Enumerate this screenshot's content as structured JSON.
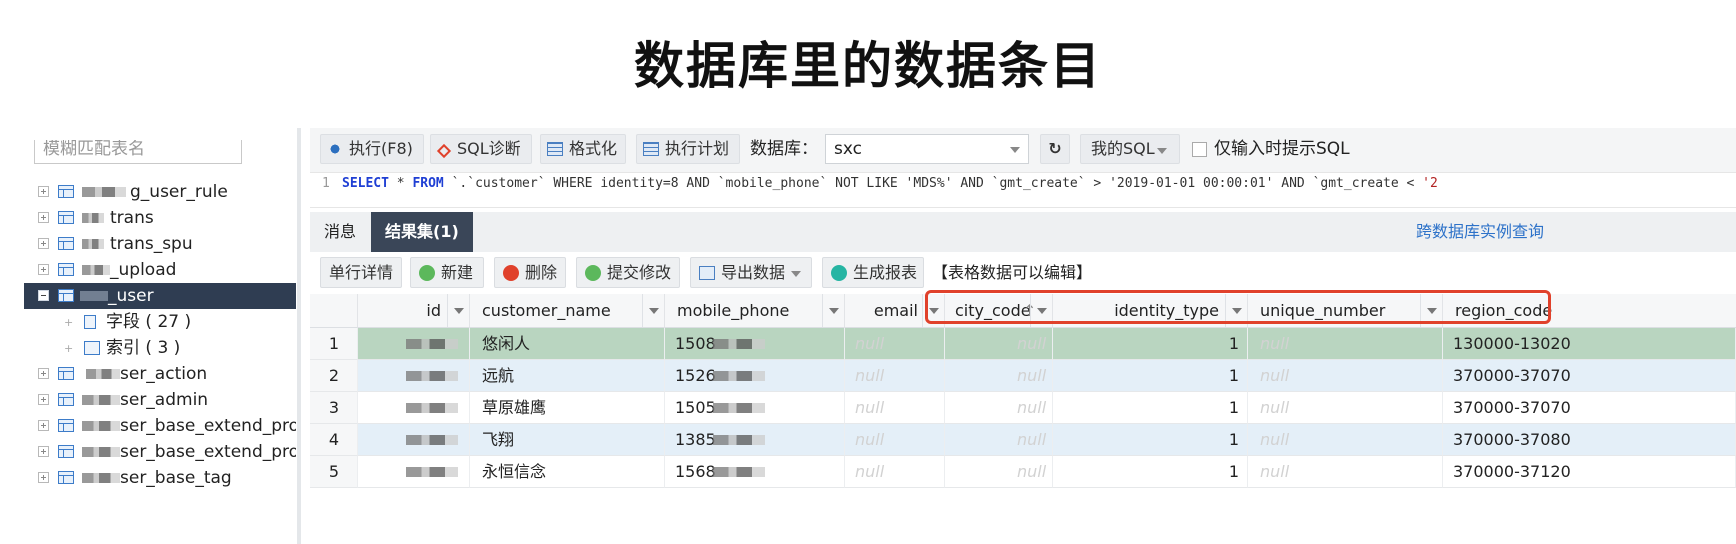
{
  "page_title": "数据库里的数据条目",
  "sidebar": {
    "search_placeholder": "模糊匹配表名",
    "items": [
      {
        "label": "g_user_rule"
      },
      {
        "label": "trans"
      },
      {
        "label": "trans_spu"
      },
      {
        "label": "_upload"
      },
      {
        "label": "_user"
      },
      {
        "label": "字段 ( 27 )"
      },
      {
        "label": "索引 ( 3 )"
      },
      {
        "label": "ser_action"
      },
      {
        "label": "ser_admin"
      },
      {
        "label": "ser_base_extend_propert"
      },
      {
        "label": "ser_base_extend_propert"
      },
      {
        "label": "ser_base_tag"
      }
    ]
  },
  "toolbar": {
    "execute": "执行(F8)",
    "sql_diag": "SQL诊断",
    "format": "格式化",
    "plan": "执行计划",
    "db_label": "数据库：",
    "db_value": "sxc",
    "my_sql": "我的SQL",
    "hint_only": "仅输入时提示SQL"
  },
  "editor": {
    "line_number": "1",
    "sql": "SELECT * FROM `.`customer` WHERE identity=8 AND `mobile_phone` NOT LIKE 'MDS%' AND `gmt_create` > '2019-01-01 00:00:01' AND `gmt_create` < '2"
  },
  "tabs": [
    {
      "label": "消息"
    },
    {
      "label": "结果集(1)"
    }
  ],
  "cross_db_link": "跨数据库实例查询",
  "result_toolbar": {
    "row_detail": "单行详情",
    "new": "新建",
    "delete": "删除",
    "commit": "提交修改",
    "export": "导出数据",
    "report": "生成报表",
    "editable_note": "【表格数据可以编辑】"
  },
  "grid": {
    "columns": [
      "id",
      "customer_name",
      "mobile_phone",
      "email",
      "city_code",
      "identity_type",
      "unique_number",
      "region_code"
    ],
    "rows": [
      {
        "num": "1",
        "customer_name": "悠闲人",
        "mobile_phone": "1508",
        "email": "null",
        "city_code": "null",
        "identity_type": "1",
        "unique_number": "null",
        "region_code": "130000-13020"
      },
      {
        "num": "2",
        "customer_name": "远航",
        "mobile_phone": "1526",
        "email": "null",
        "city_code": "null",
        "identity_type": "1",
        "unique_number": "null",
        "region_code": "370000-37070"
      },
      {
        "num": "3",
        "customer_name": "草原雄鹰",
        "mobile_phone": "1505",
        "email": "null",
        "city_code": "null",
        "identity_type": "1",
        "unique_number": "null",
        "region_code": "370000-37070"
      },
      {
        "num": "4",
        "customer_name": "飞翔",
        "mobile_phone": "1385",
        "email": "null",
        "city_code": "null",
        "identity_type": "1",
        "unique_number": "null",
        "region_code": "370000-37080"
      },
      {
        "num": "5",
        "customer_name": "永恒信念",
        "mobile_phone": "1568",
        "email": "null",
        "city_code": "null",
        "identity_type": "1",
        "unique_number": "null",
        "region_code": "370000-37120"
      }
    ]
  },
  "colors": {
    "selected_row": "#b9d5c0",
    "alt_row": "#e4eff8",
    "tree_selected": "#2f3d52",
    "active_tab": "#3a4658",
    "link": "#2d72c9",
    "highlight_box": "#e0412b"
  }
}
